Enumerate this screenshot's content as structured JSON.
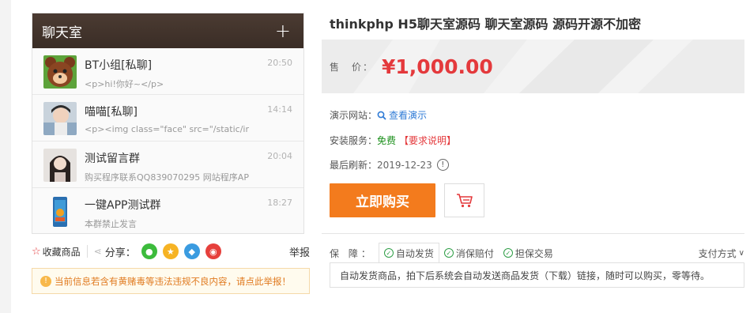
{
  "chat_preview": {
    "title": "聊天室",
    "add_icon": "plus-icon",
    "items": [
      {
        "name": "BT小组[私聊]",
        "message": "<p>hi!你好~</p>",
        "time": "20:50"
      },
      {
        "name": "喵喵[私聊]",
        "message": "<p><img class=\"face\" src=\"/static/ir",
        "time": "14:14"
      },
      {
        "name": "测试留言群",
        "message": "购买程序联系QQ839070295 网站程序AP",
        "time": "20:04"
      },
      {
        "name": "一键APP测试群",
        "message": "本群禁止发言",
        "time": "18:27"
      }
    ]
  },
  "sharebar": {
    "favorite_label": "收藏商品",
    "share_label": "分享：",
    "report_label": "举报"
  },
  "notice": {
    "text": "当前信息若含有黄赌毒等违法违规不良内容，请点此举报！"
  },
  "product": {
    "title": "thinkphp H5聊天室源码 聊天室源码 源码开源不加密",
    "price_label": "售　价：",
    "price": "¥1,000.00",
    "demo_label": "演示网站：",
    "demo_link": "查看演示",
    "install_label": "安装服务：",
    "install_value": "免费",
    "install_note": "【要求说明】",
    "refresh_label": "最后刷新：",
    "refresh_date": "2019-12-23",
    "buy_label": "立即购买"
  },
  "guarantee": {
    "label": "保 障：",
    "items": [
      "自动发货",
      "消保赔付",
      "担保交易"
    ],
    "payment_label": "支付方式",
    "description": "自动发货商品，拍下后系统会自动发送商品发货（下载）链接，随时可以购买，零等待。"
  },
  "colors": {
    "accent_orange": "#f37b1d",
    "price_red": "#e4393c",
    "link_blue": "#2f7bd6",
    "free_green": "#1a8f1a"
  }
}
